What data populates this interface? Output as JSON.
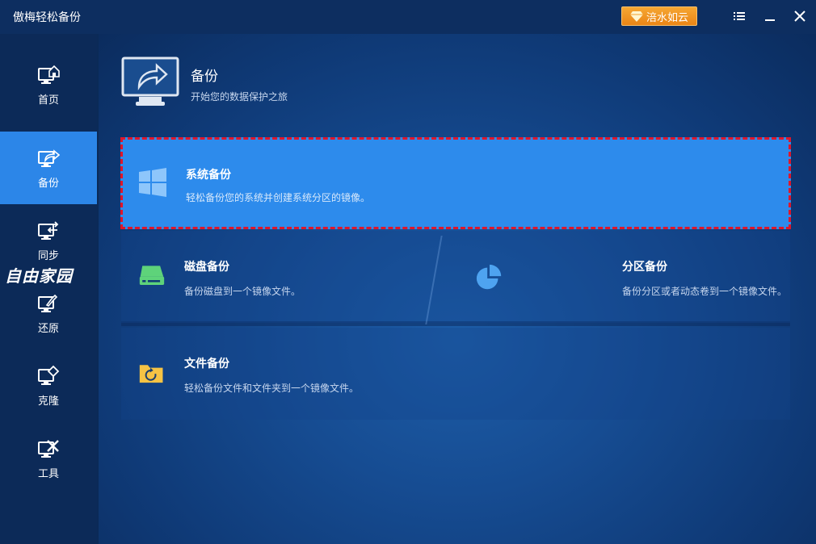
{
  "app": {
    "title": "傲梅轻松备份",
    "upgrade_label": "涪水如云"
  },
  "titlebar_icons": [
    "menu-icon",
    "minimize-icon",
    "close-icon"
  ],
  "sidebar": {
    "items": [
      {
        "label": "首页",
        "icon": "home-icon"
      },
      {
        "label": "备份",
        "icon": "backup-icon",
        "active": true
      },
      {
        "label": "同步",
        "icon": "sync-icon"
      },
      {
        "label": "还原",
        "icon": "restore-icon"
      },
      {
        "label": "克隆",
        "icon": "clone-icon"
      },
      {
        "label": "工具",
        "icon": "tools-icon"
      }
    ]
  },
  "watermark": "自由家园",
  "header": {
    "title": "备份",
    "subtitle": "开始您的数据保护之旅"
  },
  "cards": {
    "system": {
      "title": "系统备份",
      "desc": "轻松备份您的系统并创建系统分区的镜像。",
      "icon": "windows-icon"
    },
    "disk": {
      "title": "磁盘备份",
      "desc": "备份磁盘到一个镜像文件。",
      "icon": "disk-icon"
    },
    "partition": {
      "title": "分区备份",
      "desc": "备份分区或者动态卷到一个镜像文件。",
      "icon": "pie-icon"
    },
    "file": {
      "title": "文件备份",
      "desc": "轻松备份文件和文件夹到一个镜像文件。",
      "icon": "folder-icon"
    }
  },
  "colors": {
    "accent": "#2c86e8",
    "highlight_border": "#e0162a",
    "upgrade": "#ea8516",
    "disk_green": "#5ed37a",
    "folder_yellow": "#f6c344"
  }
}
